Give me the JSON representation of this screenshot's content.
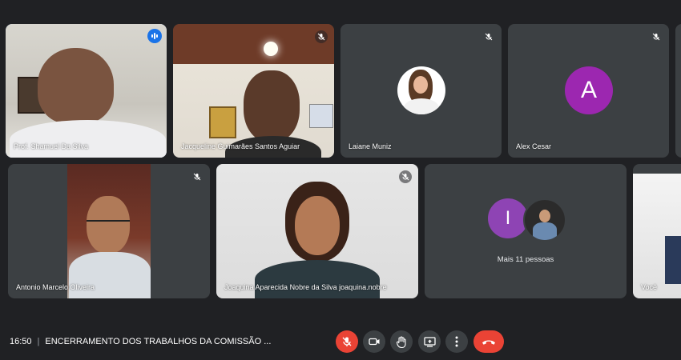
{
  "colors": {
    "background": "#202124",
    "tile": "#3c4043",
    "active_border": "#8ab4f8",
    "speaking_badge": "#1a73e8",
    "avatar_alex": "#9c27b0",
    "avatar_i": "#8e44b4",
    "hangup": "#ea4335"
  },
  "participants": [
    {
      "name": "Prof. Shamuel Da Silva",
      "speaking": true
    },
    {
      "name": "Jacqueline Guimarães Santos Aguiar",
      "muted": true
    },
    {
      "name": "Laiane Muniz",
      "muted": true
    },
    {
      "name": "Alex Cesar",
      "muted": true,
      "avatar_letter": "A"
    },
    {
      "name": "Antonio Marcelo Oliveira",
      "muted": true
    },
    {
      "name": "Joaquina Aparecida Nobre da Silva joaquina.nobre",
      "muted": true
    },
    {
      "label": "Mais 11 pessoas",
      "avatar_letter": "I"
    },
    {
      "name": "Você"
    }
  ],
  "bottom_bar": {
    "time": "16:50",
    "separator": "|",
    "meeting_title": "ENCERRAMENTO DOS TRABALHOS DA COMISSÃO ...",
    "controls": [
      {
        "icon": "mic-off-icon",
        "state": "muted"
      },
      {
        "icon": "camera-icon"
      },
      {
        "icon": "raise-hand-icon"
      },
      {
        "icon": "present-screen-icon"
      },
      {
        "icon": "more-options-icon"
      },
      {
        "icon": "hang-up-icon"
      }
    ]
  }
}
